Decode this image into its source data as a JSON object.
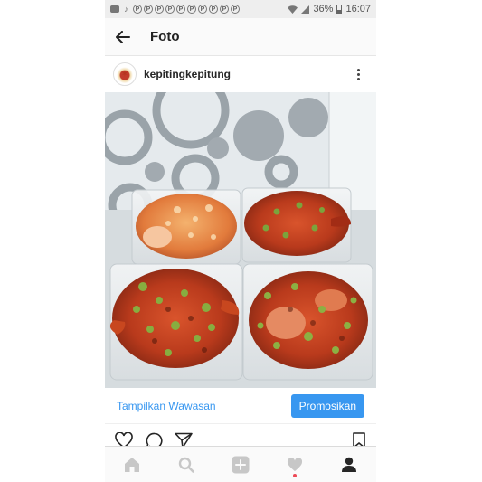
{
  "status_bar": {
    "battery": "36%",
    "time": "16:07",
    "notification_icons": [
      "message-icon",
      "mute-icon",
      "p-icon",
      "p-icon",
      "p-icon",
      "p-icon",
      "p-icon",
      "p-icon",
      "p-icon",
      "p-icon",
      "p-icon",
      "p-icon"
    ]
  },
  "header": {
    "title": "Foto"
  },
  "post": {
    "username": "kepitingkepitung",
    "insights_label": "Tampilkan Wawasan",
    "promote_label": "Promosikan"
  },
  "colors": {
    "accent": "#3897f0",
    "notification_dot": "#ed4956",
    "icon_gray": "#c7c7c7"
  },
  "bottom_nav": [
    "home-icon",
    "search-icon",
    "add-post-icon",
    "activity-icon",
    "profile-icon"
  ]
}
